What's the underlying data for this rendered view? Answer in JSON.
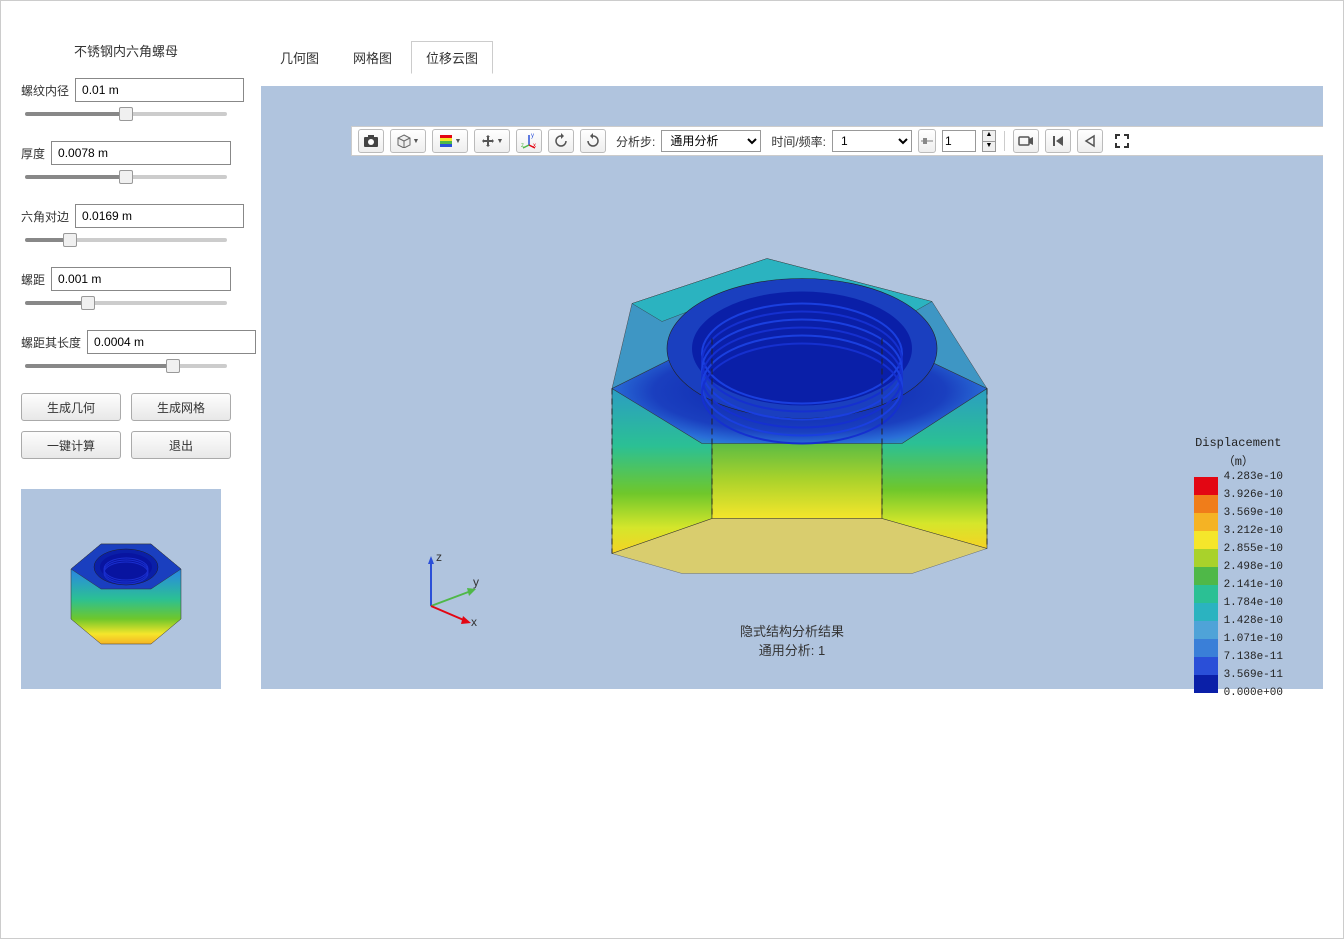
{
  "sidebar": {
    "title": "不锈钢内六角螺母",
    "params": [
      {
        "label": "螺纹内径",
        "value": "0.01 m",
        "slider_pct": 50
      },
      {
        "label": "厚度",
        "value": "0.0078 m",
        "slider_pct": 50
      },
      {
        "label": "六角对边",
        "value": "0.0169 m",
        "slider_pct": 20
      },
      {
        "label": "螺距",
        "value": "0.001 m",
        "slider_pct": 30
      },
      {
        "label": "螺距其长度",
        "value": "0.0004 m",
        "slider_pct": 75
      }
    ],
    "buttons": {
      "gen_geometry": "生成几何",
      "gen_mesh": "生成网格",
      "one_click_calc": "一键计算",
      "exit": "退出"
    }
  },
  "tabs": [
    {
      "label": "几何图",
      "active": false
    },
    {
      "label": "网格图",
      "active": false
    },
    {
      "label": "位移云图",
      "active": true
    }
  ],
  "toolbar": {
    "analysis_step_label": "分析步:",
    "analysis_step_value": "通用分析",
    "time_freq_label": "时间/频率:",
    "time_freq_value": "1",
    "spinner_value": "1"
  },
  "result": {
    "line1": "隐式结构分析结果",
    "line2": "通用分析: 1"
  },
  "legend": {
    "title": "Displacement",
    "unit": "（m）",
    "colors": [
      "#e30613",
      "#f07d1a",
      "#f5b324",
      "#f5e62b",
      "#a9d22b",
      "#4fb848",
      "#2bc094",
      "#2bb3c0",
      "#4fa3d8",
      "#3a7fd8",
      "#2a4fd8",
      "#0a1fa8"
    ],
    "values": [
      "4.283e-10",
      "3.926e-10",
      "3.569e-10",
      "3.212e-10",
      "2.855e-10",
      "2.498e-10",
      "2.141e-10",
      "1.784e-10",
      "1.428e-10",
      "1.071e-10",
      "7.138e-11",
      "3.569e-11",
      "0.000e+00"
    ]
  },
  "chart_data": {
    "type": "table",
    "title": "Displacement (m) color scale",
    "values": [
      4.283e-10,
      3.926e-10,
      3.569e-10,
      3.212e-10,
      2.855e-10,
      2.498e-10,
      2.141e-10,
      1.784e-10,
      1.428e-10,
      1.071e-10,
      7.138e-11,
      3.569e-11,
      0.0
    ]
  },
  "axes": {
    "x": "x",
    "y": "y",
    "z": "z"
  }
}
